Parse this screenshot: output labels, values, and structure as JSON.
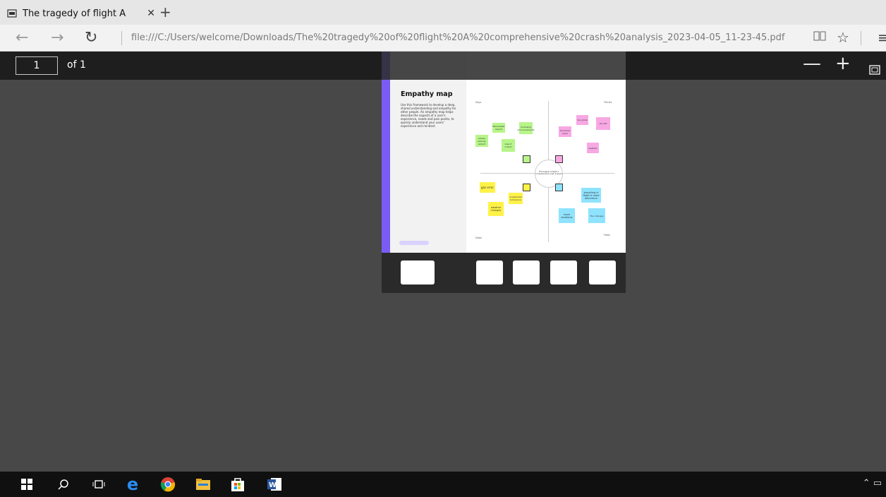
{
  "browser": {
    "tab": {
      "title": "The tragedy of flight A ‹",
      "close_glyph": "✕"
    },
    "new_tab_glyph": "+",
    "nav": {
      "back": "←",
      "forward": "→",
      "refresh": "↻"
    },
    "url": "file:///C:/Users/welcome/Downloads/The%20tragedy%20of%20flight%20A%20comprehensive%20crash%20analysis_2023-04-05_11-23-45.pdf",
    "reading_view_icon": "reading-view-icon",
    "favorites_icon": "favorites-star-icon",
    "more_glyph": "≡"
  },
  "pdf_toolbar": {
    "page_number": "1",
    "page_total": "of 1",
    "zoom_out": "—",
    "zoom_in": "+",
    "fit_icon": "fit-page-icon"
  },
  "document": {
    "title": "Empathy map",
    "description": "Use this framework to develop a deep, shared understanding and empathy for other people. An empathy map helps describe the aspects of a user's experience, needs and pain points, to quickly understand your users' experience and mindset.",
    "center_label": "The tragedy of flight A comprehensive crash analysis",
    "notes": {
      "green": [
        "Manchester airport",
        "Confusing announcements",
        "planes leaving airport",
        "loss of control"
      ],
      "pink": [
        "too pilots",
        "aircraft",
        "technical issue",
        "weather"
      ],
      "yellow": [
        "gas error",
        "unexpected turbulence",
        "weather changes"
      ],
      "blue": [
        "travelling in flight is more adventure",
        "more emotions",
        "The changes"
      ]
    }
  },
  "taskbar": {
    "icons": [
      "windows-start-icon",
      "search-icon",
      "task-view-icon",
      "edge-icon",
      "chrome-icon",
      "file-explorer-icon",
      "store-icon",
      "word-icon"
    ],
    "tray": "⌃ ▭"
  }
}
